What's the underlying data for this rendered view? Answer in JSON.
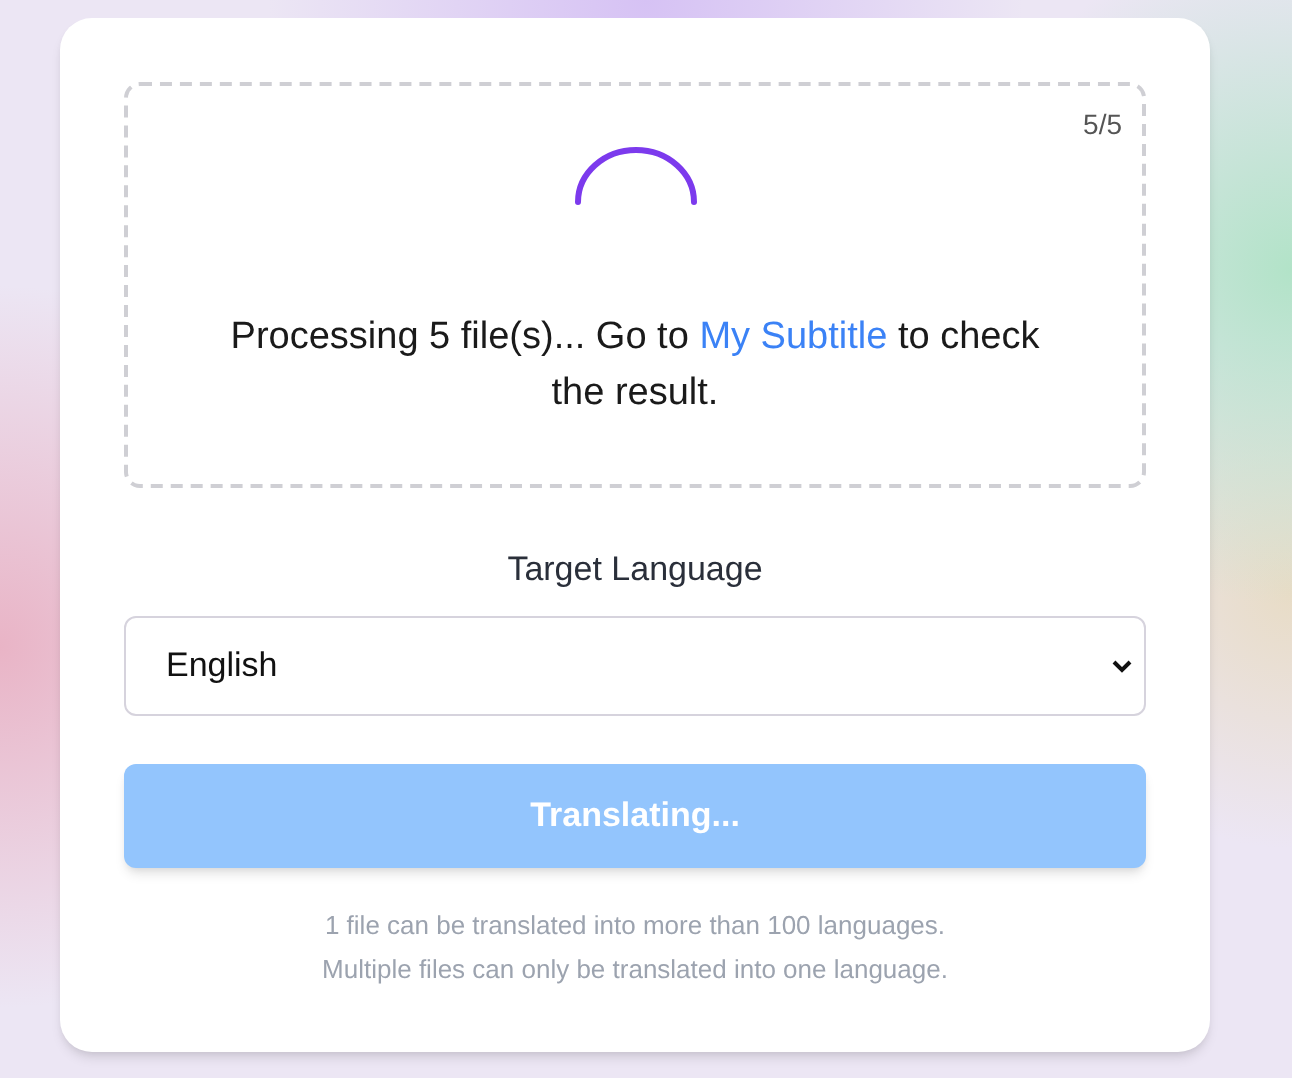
{
  "upload_area": {
    "counter": "5/5",
    "loading": true,
    "message": {
      "before": "Processing 5 file(s)... Go to ",
      "link": "My Subtitle",
      "after": " to check the result."
    }
  },
  "target_language": {
    "label": "Target Language",
    "value": "English"
  },
  "translate_button": {
    "label": "Translating...",
    "disabled": true
  },
  "notes": [
    "1 file can be translated into more than 100 languages.",
    "Multiple files can only be translated into one language."
  ]
}
